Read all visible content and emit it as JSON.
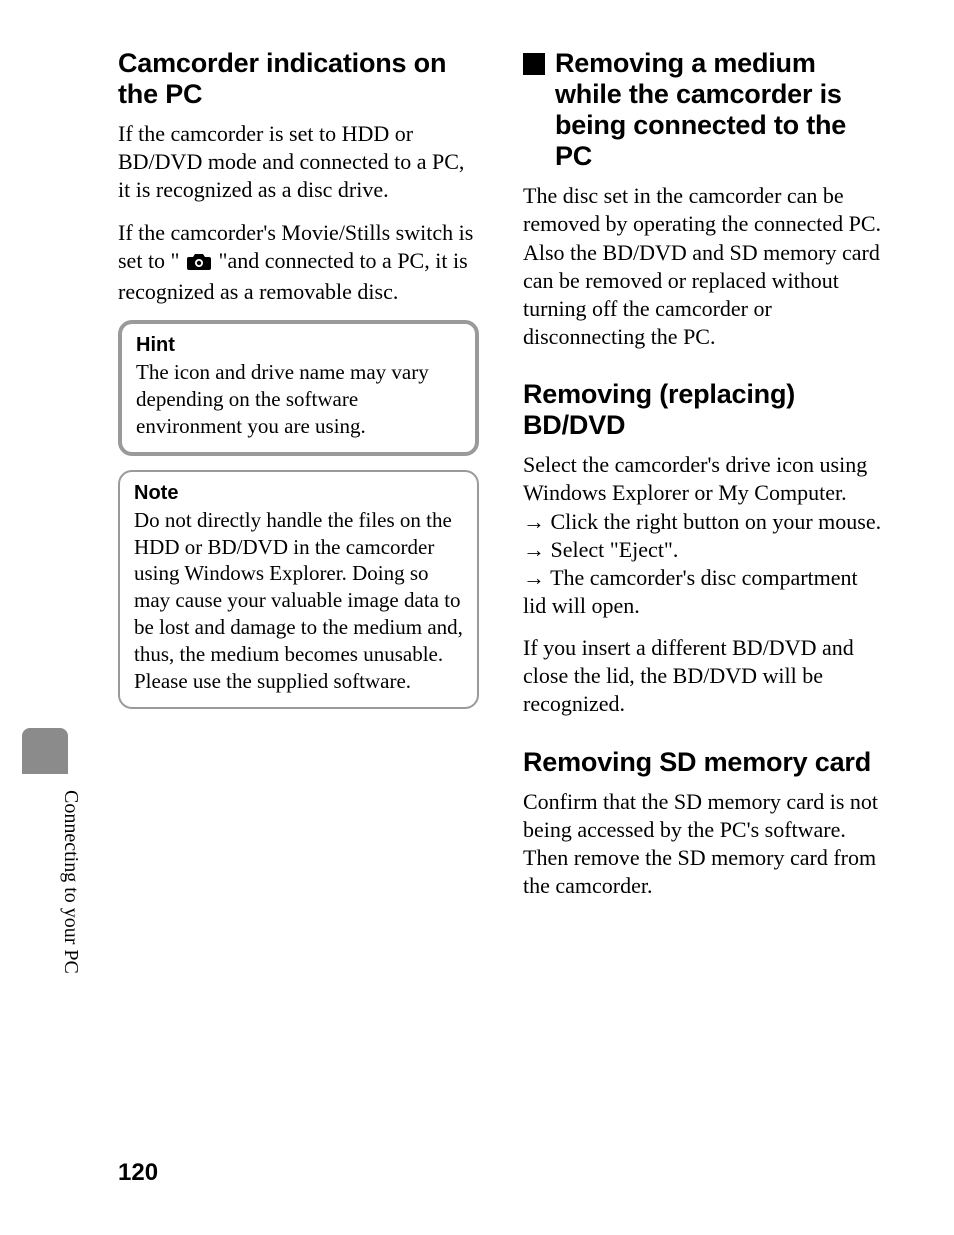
{
  "pageNumber": "120",
  "sideLabel": "Connecting to your PC",
  "left": {
    "h1": "Camcorder indications on the PC",
    "p1": "If the camcorder is set to HDD or BD/DVD mode and connected to a PC, it is recognized as a disc drive.",
    "p2a": "If the camcorder's Movie/Stills switch is set to \"",
    "p2b": "\"and connected to a PC, it is recognized as a removable disc.",
    "hintLabel": "Hint",
    "hintBody": "The icon and drive name may vary depending on the software environment you are using.",
    "noteLabel": "Note",
    "noteBody": "Do not directly handle the files on the HDD or BD/DVD in the camcorder using Windows Explorer. Doing so may cause your valuable image data to be lost and damage to the medium and, thus, the medium becomes unusable. Please use the supplied software."
  },
  "right": {
    "h1": "Removing a medium while the camcorder is being connected to the PC",
    "p1": "The disc set in the camcorder can be removed by operating the connected PC. Also the BD/DVD and SD memory card can be removed or replaced without turning off the camcorder or disconnecting the PC.",
    "h2": "Removing (replacing) BD/DVD",
    "p2": "Select the camcorder's drive icon using Windows Explorer or My Computer.",
    "step1": " Click the right button on your mouse.",
    "step2": " Select \"Eject\".",
    "step3": " The camcorder's disc compartment lid will open.",
    "p3": "If you insert a different BD/DVD and close the lid, the BD/DVD will be recognized.",
    "h3": "Removing SD memory card",
    "p4": "Confirm that the SD memory card is not being accessed by the PC's software. Then remove the SD memory card from the camcorder."
  }
}
